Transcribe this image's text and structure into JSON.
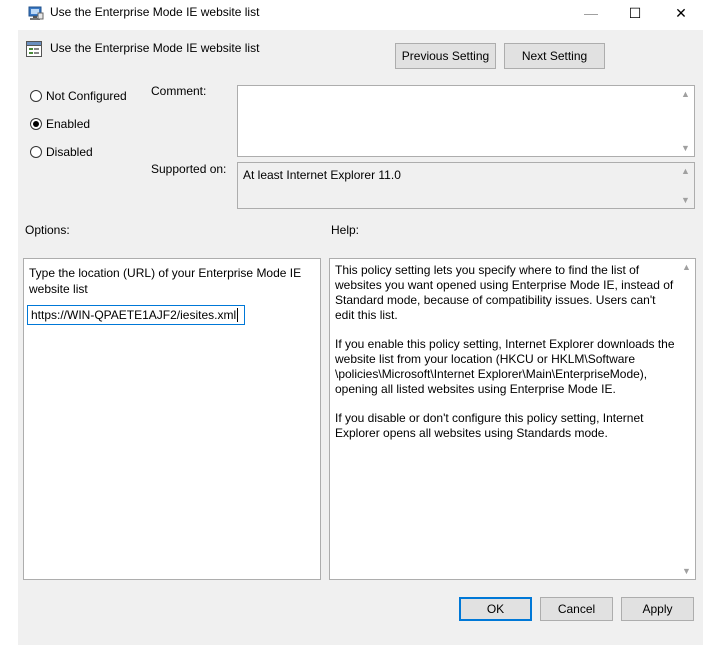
{
  "window": {
    "title": "Use the Enterprise Mode IE website list",
    "minimize_glyph": "—",
    "maximize_glyph": "☐",
    "close_glyph": "✕"
  },
  "header": {
    "setting_name": "Use the Enterprise Mode IE website list",
    "prev_label": "Previous Setting",
    "next_label": "Next Setting"
  },
  "state": {
    "options": [
      {
        "label": "Not Configured",
        "selected": false
      },
      {
        "label": "Enabled",
        "selected": true
      },
      {
        "label": "Disabled",
        "selected": false
      }
    ]
  },
  "comment": {
    "label": "Comment:",
    "value": ""
  },
  "supported": {
    "label": "Supported on:",
    "value": "At least Internet Explorer 11.0"
  },
  "options_pane": {
    "label": "Options:",
    "field_label": "Type the location (URL) of your Enterprise Mode IE website list",
    "field_value": "https://WIN-QPAETE1AJF2/iesites.xml"
  },
  "help_pane": {
    "label": "Help:",
    "paragraphs": [
      "This policy setting lets you specify where to find the list of websites you want opened using Enterprise Mode IE, instead of Standard mode, because of compatibility issues. Users can't edit this list.",
      "If you enable this policy setting, Internet Explorer downloads the website list from your location (HKCU or HKLM\\Software \\policies\\Microsoft\\Internet Explorer\\Main\\EnterpriseMode), opening all listed websites using Enterprise Mode IE.",
      "If you disable or don't configure this policy setting, Internet Explorer opens all websites using Standards mode."
    ]
  },
  "footer": {
    "ok_label": "OK",
    "cancel_label": "Cancel",
    "apply_label": "Apply"
  },
  "colors": {
    "dialog_bg": "#f0f0f0",
    "accent": "#0078d7",
    "button_bg": "#e1e1e1"
  }
}
